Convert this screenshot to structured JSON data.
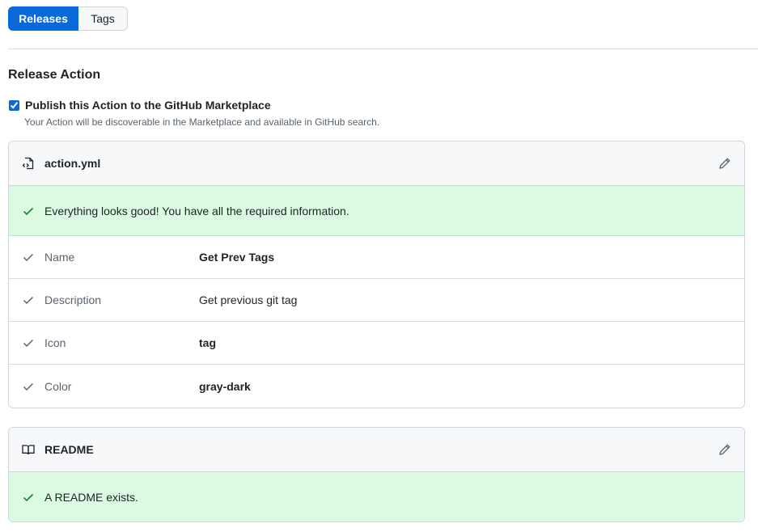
{
  "tabs": [
    {
      "label": "Releases",
      "active": true
    },
    {
      "label": "Tags",
      "active": false
    }
  ],
  "section": {
    "title": "Release Action"
  },
  "publish": {
    "checked": true,
    "label": "Publish this Action to the GitHub Marketplace",
    "help": "Your Action will be discoverable in the Marketplace and available in GitHub search."
  },
  "action_file": {
    "title": "action.yml",
    "icon": "file-code-icon",
    "status": "Everything looks good! You have all the required information.",
    "rows": [
      {
        "label": "Name",
        "value": "Get Prev Tags"
      },
      {
        "label": "Description",
        "value": "Get previous git tag"
      },
      {
        "label": "Icon",
        "value": "tag"
      },
      {
        "label": "Color",
        "value": "gray-dark"
      }
    ]
  },
  "readme": {
    "title": "README",
    "icon": "book-icon",
    "status": "A README exists."
  },
  "colors": {
    "accent": "#0969da",
    "success_bg": "#dafbe1",
    "success_icon": "#1a7f37"
  }
}
